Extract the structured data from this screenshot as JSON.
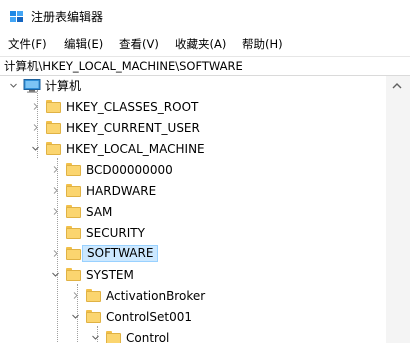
{
  "window": {
    "title": "注册表编辑器"
  },
  "menu": [
    "文件(F)",
    "编辑(E)",
    "查看(V)",
    "收藏夹(A)",
    "帮助(H)"
  ],
  "address": "计算机\\HKEY_LOCAL_MACHINE\\SOFTWARE",
  "tree": {
    "root": "计算机",
    "hkcr": "HKEY_CLASSES_ROOT",
    "hkcu": "HKEY_CURRENT_USER",
    "hklm": "HKEY_LOCAL_MACHINE",
    "bcd": "BCD00000000",
    "hardware": "HARDWARE",
    "sam": "SAM",
    "security": "SECURITY",
    "software": "SOFTWARE",
    "system": "SYSTEM",
    "activation": "ActivationBroker",
    "controlset": "ControlSet001",
    "control": "Control"
  },
  "selected": "SOFTWARE",
  "colors": {
    "selection": "#cce8ff",
    "folder": "#fbd56f"
  }
}
